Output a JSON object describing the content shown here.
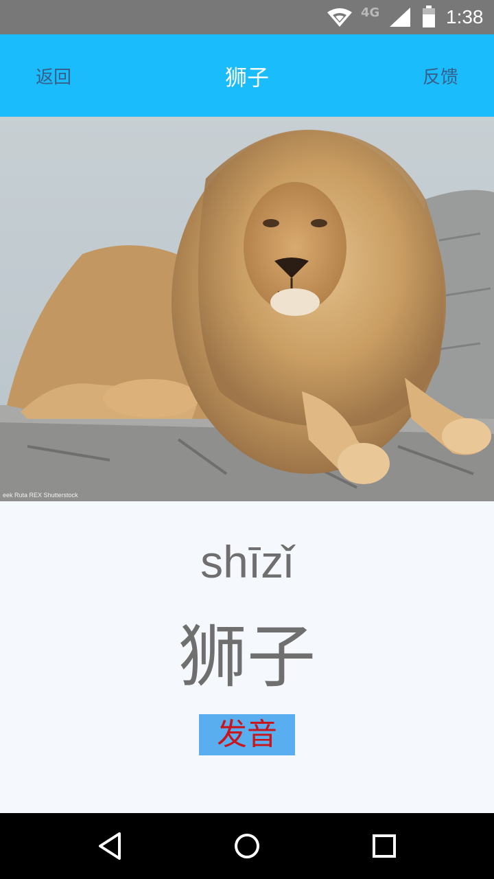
{
  "status_bar": {
    "network_type": "4G",
    "time": "1:38",
    "icons": [
      "wifi-icon",
      "cell-signal-icon",
      "battery-icon"
    ]
  },
  "toolbar": {
    "back_label": "返回",
    "title": "狮子",
    "feedback_label": "反馈"
  },
  "photo": {
    "subject": "lion",
    "credit_text": "eek Ruta REX Shutterstock"
  },
  "word": {
    "pinyin": "shīzǐ",
    "hanzi": "狮子"
  },
  "speak_button": {
    "label": "发音"
  },
  "nav_bar": {
    "icons": [
      "back-triangle-icon",
      "home-circle-icon",
      "recents-square-icon"
    ]
  },
  "colors": {
    "status_bar": "#787878",
    "toolbar": "#1bbcfb",
    "toolbar_link": "#36608b",
    "page_background": "#f5f9fd",
    "word_text": "#6f6f6f",
    "button_background": "#58aeef",
    "button_text": "#c8161d",
    "nav_bar": "#000000"
  }
}
